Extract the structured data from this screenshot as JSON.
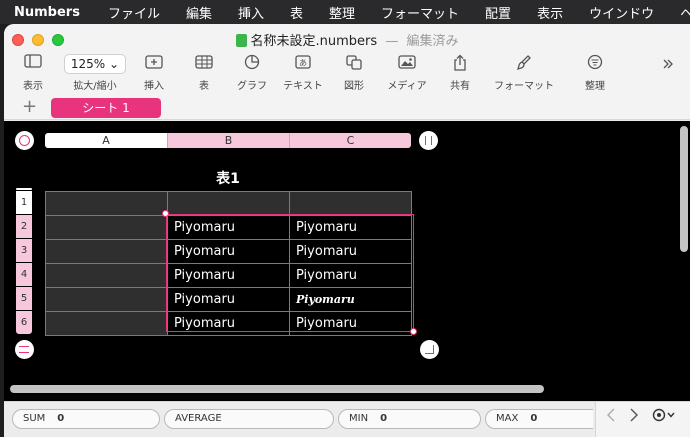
{
  "menubar": {
    "apple": "",
    "app": "Numbers",
    "items": [
      "ファイル",
      "編集",
      "挿入",
      "表",
      "整理",
      "フォーマット",
      "配置",
      "表示",
      "ウインドウ",
      "ヘルプ"
    ]
  },
  "window": {
    "title": "名称未設定.numbers",
    "separator": "—",
    "status": "編集済み"
  },
  "toolbar": {
    "view": "表示",
    "zoom_value": "125%",
    "zoom_chevron": "⌄",
    "zoom": "拡大/縮小",
    "insert": "挿入",
    "table": "表",
    "chart": "グラフ",
    "text": "テキスト",
    "shape": "図形",
    "media": "メディア",
    "share": "共有",
    "format": "フォーマット",
    "organize": "整理"
  },
  "tabs": {
    "add": "+",
    "sheet": "シート 1"
  },
  "spreadsheet": {
    "columns": [
      "A",
      "B",
      "C"
    ],
    "table_title": "表1",
    "rows": [
      "1",
      "2",
      "3",
      "4",
      "5",
      "6"
    ],
    "cells": [
      [
        "",
        "",
        ""
      ],
      [
        "",
        "Piyomaru",
        "Piyomaru"
      ],
      [
        "",
        "Piyomaru",
        "Piyomaru"
      ],
      [
        "",
        "Piyomaru",
        "Piyomaru"
      ],
      [
        "",
        "Piyomaru",
        "Piyomaru"
      ],
      [
        "",
        "Piyomaru",
        "Piyomaru"
      ]
    ]
  },
  "statusbar": {
    "sum_label": "SUM",
    "sum_value": "0",
    "avg_label": "AVERAGE",
    "min_label": "MIN",
    "min_value": "0",
    "max_label": "MAX",
    "max_value": "0"
  },
  "colors": {
    "accent": "#e8347c",
    "selected_header": "#f7c7dc"
  }
}
